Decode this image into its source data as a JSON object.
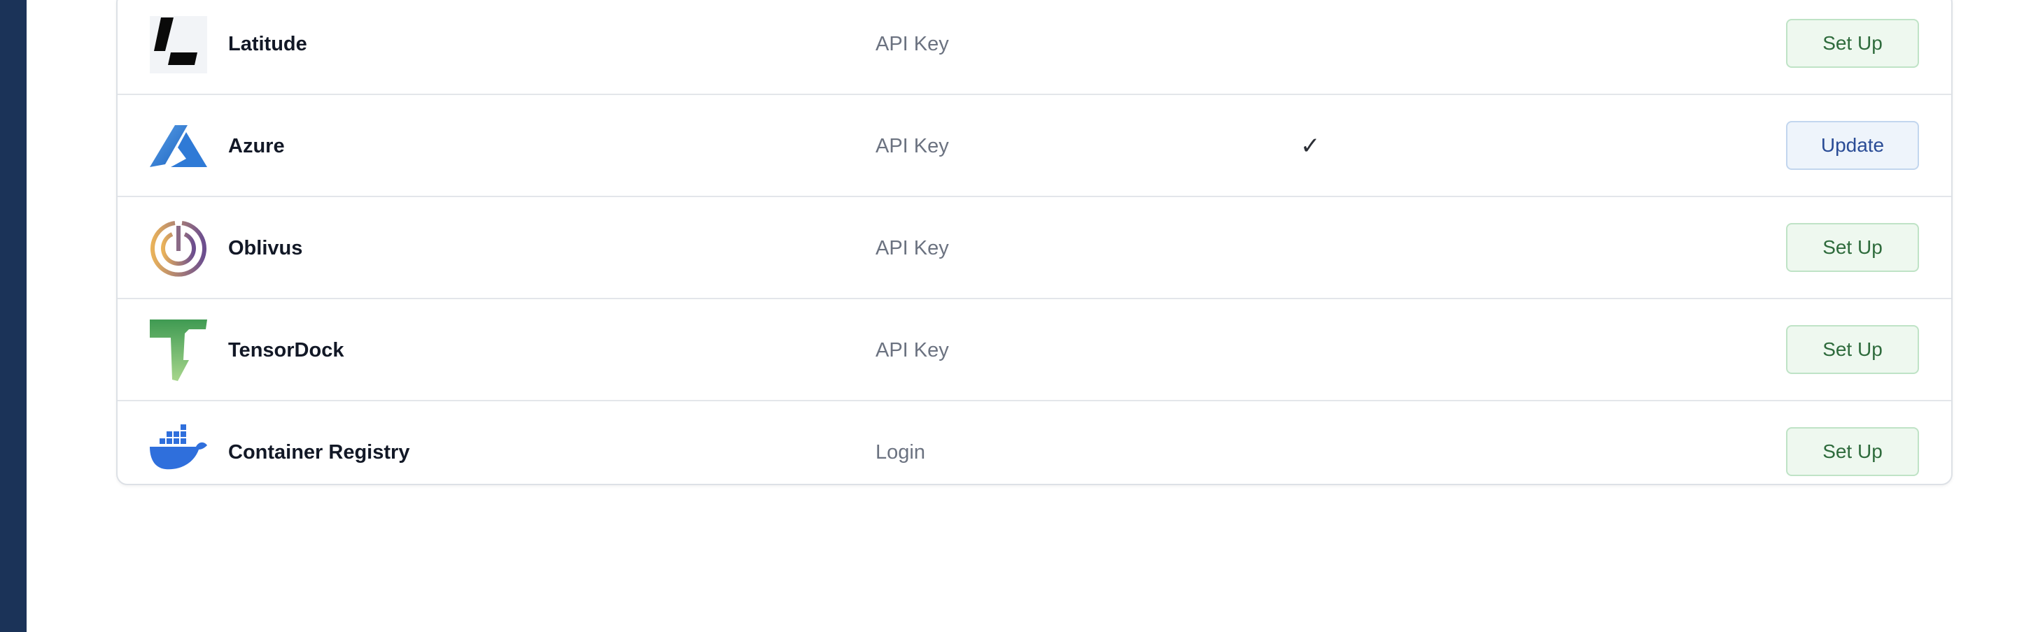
{
  "colors": {
    "sidebar_bg": "#1b3358",
    "setup_button_bg": "#eef8ef",
    "setup_button_text": "#2e6b3c",
    "update_button_bg": "#eef4fb",
    "update_button_text": "#2a4c96"
  },
  "integrations": [
    {
      "name": "Latitude",
      "auth_type": "API Key",
      "configured": "",
      "action": "Set Up",
      "icon": "latitude-logo-icon"
    },
    {
      "name": "Azure",
      "auth_type": "API Key",
      "configured": "✓",
      "action": "Update",
      "icon": "azure-logo-icon"
    },
    {
      "name": "Oblivus",
      "auth_type": "API Key",
      "configured": "",
      "action": "Set Up",
      "icon": "oblivus-logo-icon"
    },
    {
      "name": "TensorDock",
      "auth_type": "API Key",
      "configured": "",
      "action": "Set Up",
      "icon": "tensordock-logo-icon"
    },
    {
      "name": "Container Registry",
      "auth_type": "Login",
      "configured": "",
      "action": "Set Up",
      "icon": "docker-logo-icon"
    }
  ]
}
